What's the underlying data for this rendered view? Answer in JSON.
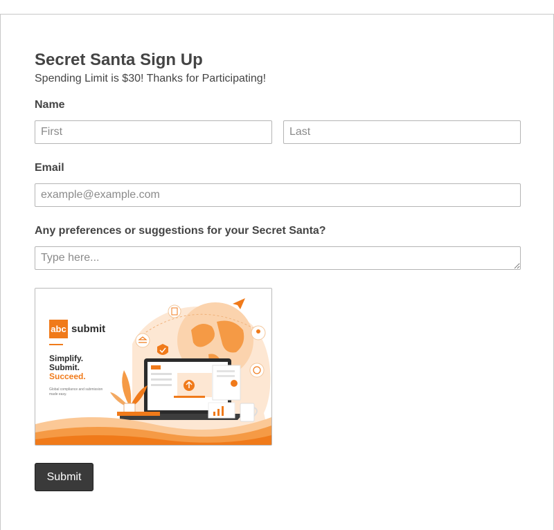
{
  "form": {
    "title": "Secret Santa Sign Up",
    "subtitle": "Spending Limit is $30! Thanks for Participating!",
    "name": {
      "label": "Name",
      "first_placeholder": "First",
      "last_placeholder": "Last"
    },
    "email": {
      "label": "Email",
      "placeholder": "example@example.com"
    },
    "preferences": {
      "label": "Any preferences or suggestions for your Secret Santa?",
      "placeholder": "Type here..."
    },
    "promo": {
      "logo_mark": "abc",
      "logo_word": "submit",
      "tagline_line1": "Simplify.",
      "tagline_line2": "Submit.",
      "tagline_line3": "Succeed.",
      "blurb": "Global compliance and submission made easy."
    },
    "submit_label": "Submit"
  },
  "colors": {
    "accent_orange": "#f07a1a",
    "button_bg": "#3a3a3a",
    "text": "#444444",
    "border": "#b4b4b4"
  }
}
